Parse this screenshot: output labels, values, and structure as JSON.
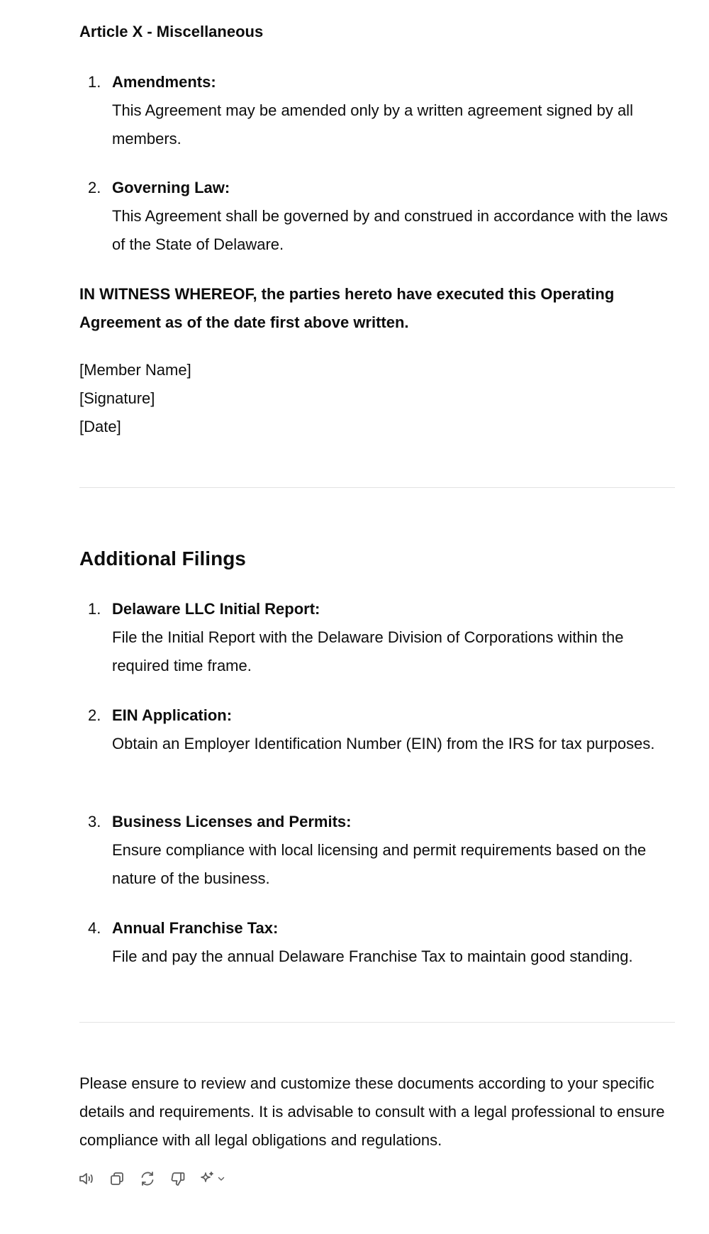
{
  "article": {
    "title": "Article X - Miscellaneous",
    "items": [
      {
        "number": "1.",
        "heading": "Amendments:",
        "text": "This Agreement may be amended only by a written agreement signed by all members."
      },
      {
        "number": "2.",
        "heading": "Governing Law:",
        "text": "This Agreement shall be governed by and construed in accordance with the laws of the State of Delaware."
      }
    ]
  },
  "witness": "IN WITNESS WHEREOF, the parties hereto have executed this Operating Agreement as of the date first above written.",
  "signature_block": {
    "member_name": "[Member Name]",
    "signature": "[Signature]",
    "date": "[Date]"
  },
  "additional_filings": {
    "heading": "Additional Filings",
    "items": [
      {
        "number": "1.",
        "heading": "Delaware LLC Initial Report:",
        "text": "File the Initial Report with the Delaware Division of Corporations within the required time frame."
      },
      {
        "number": "2.",
        "heading": "EIN Application:",
        "text": "Obtain an Employer Identification Number (EIN) from the IRS for tax purposes."
      },
      {
        "number": "3.",
        "heading": "Business Licenses and Permits:",
        "text": "Ensure compliance with local licensing and permit requirements based on the nature of the business."
      },
      {
        "number": "4.",
        "heading": "Annual Franchise Tax:",
        "text": "File and pay the annual Delaware Franchise Tax to maintain good standing."
      }
    ]
  },
  "closing": "Please ensure to review and customize these documents according to your specific details and requirements. It is advisable to consult with a legal professional to ensure compliance with all legal obligations and regulations.",
  "actions": {
    "icons": [
      "speaker-icon",
      "copy-icon",
      "regenerate-icon",
      "thumbs-down-icon",
      "sparkle-icon",
      "chevron-down-icon"
    ],
    "icon_color": "#5d5d5d"
  }
}
